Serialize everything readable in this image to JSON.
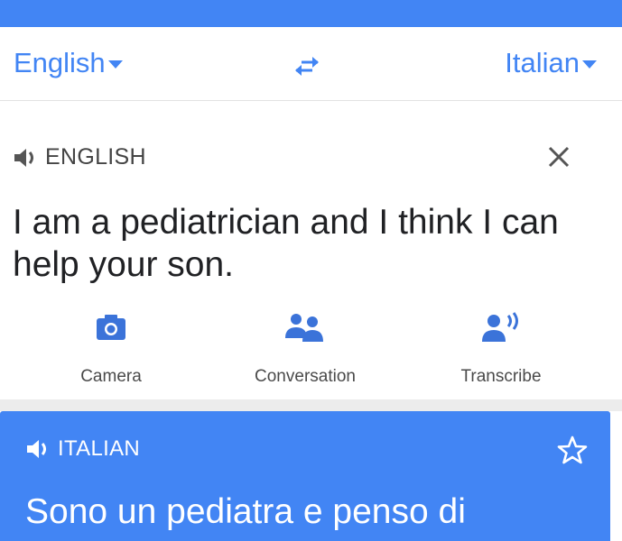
{
  "header": {
    "color": "#4285f4"
  },
  "language_bar": {
    "source_language": "English",
    "target_language": "Italian",
    "swap_icon": "swap-arrows-icon"
  },
  "source": {
    "label": "ENGLISH",
    "speaker_icon": "volume-icon",
    "close_icon": "close-icon",
    "text": "I am a pediatrician and I think I can help your son."
  },
  "actions": [
    {
      "label": "Camera",
      "icon": "camera-icon"
    },
    {
      "label": "Conversation",
      "icon": "conversation-icon"
    },
    {
      "label": "Transcribe",
      "icon": "transcribe-icon"
    }
  ],
  "result": {
    "label": "ITALIAN",
    "speaker_icon": "volume-icon",
    "star_icon": "star-outline-icon",
    "text": "Sono un pediatra e penso di",
    "background": "#4285f4"
  }
}
